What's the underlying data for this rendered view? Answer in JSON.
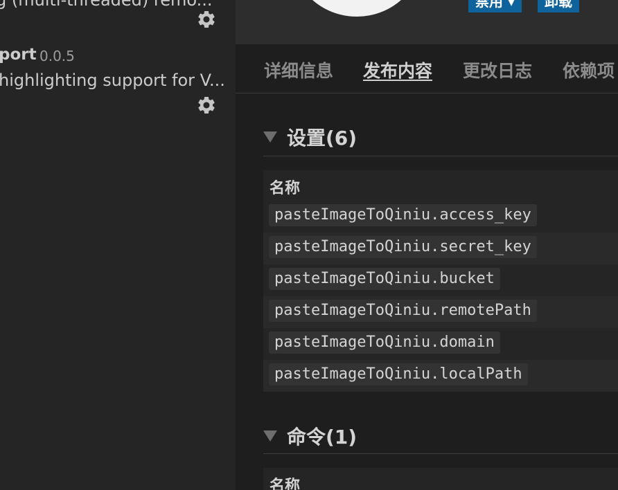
{
  "sidebar": {
    "items": [
      {
        "description": "g (multi-threaded) remo..."
      },
      {
        "name": "port",
        "version": "0.0.5",
        "description": "highlighting support for V..."
      }
    ]
  },
  "header": {
    "buttons": {
      "disable_label": "禁用 ▾",
      "uninstall_label": "卸载"
    }
  },
  "tabs": [
    {
      "label": "详细信息",
      "active": false
    },
    {
      "label": "发布内容",
      "active": true
    },
    {
      "label": "更改日志",
      "active": false
    },
    {
      "label": "依赖项",
      "active": false
    }
  ],
  "settings_section": {
    "title": "设置(6)",
    "column_header": "名称",
    "rows": [
      "pasteImageToQiniu.access_key",
      "pasteImageToQiniu.secret_key",
      "pasteImageToQiniu.bucket",
      "pasteImageToQiniu.remotePath",
      "pasteImageToQiniu.domain",
      "pasteImageToQiniu.localPath"
    ]
  },
  "commands_section": {
    "title": "命令(1)",
    "column_header": "名称"
  },
  "colors": {
    "accent_button": "#0e639c",
    "background": "#1e1e1e",
    "sidebar": "#252526"
  },
  "icons": {
    "manage": "gear-icon",
    "collapse": "triangle-down-icon"
  }
}
